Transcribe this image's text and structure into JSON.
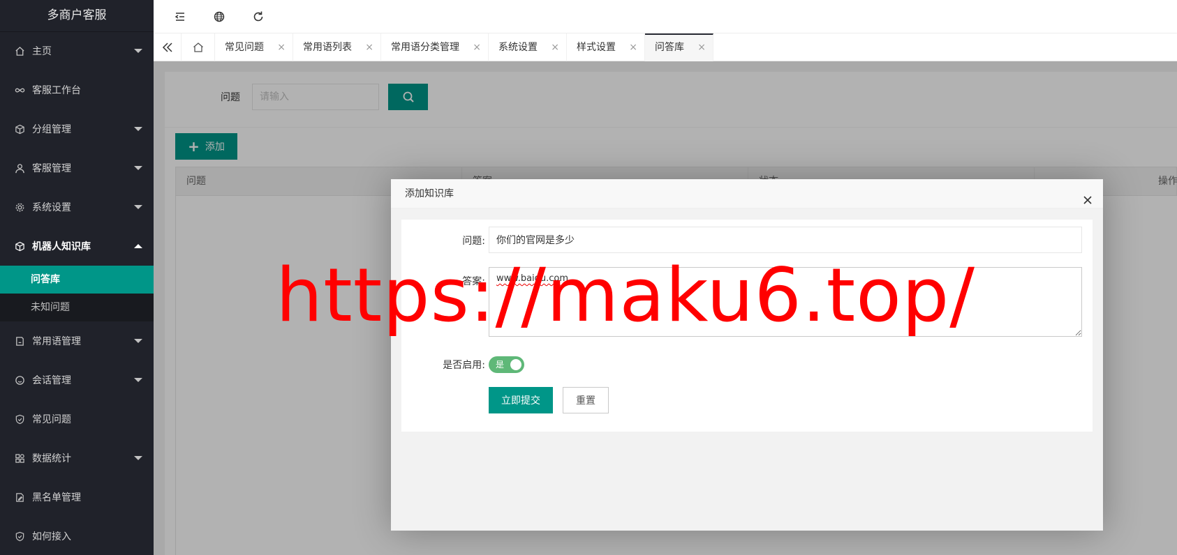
{
  "sidebar": {
    "title": "多商户客服",
    "items": [
      {
        "label": "主页",
        "icon": "home-icon",
        "has_children": true
      },
      {
        "label": "客服工作台",
        "icon": "infinity-icon",
        "has_children": false
      },
      {
        "label": "分组管理",
        "icon": "cube-icon",
        "has_children": true
      },
      {
        "label": "客服管理",
        "icon": "user-icon",
        "has_children": true
      },
      {
        "label": "系统设置",
        "icon": "gear-icon",
        "has_children": true
      },
      {
        "label": "机器人知识库",
        "icon": "cube-icon",
        "has_children": true,
        "open": true
      },
      {
        "label": "常用语管理",
        "icon": "note-icon",
        "has_children": true
      },
      {
        "label": "会话管理",
        "icon": "smile-icon",
        "has_children": true
      },
      {
        "label": "常见问题",
        "icon": "shield-icon",
        "has_children": false
      },
      {
        "label": "数据统计",
        "icon": "grid-icon",
        "has_children": true
      },
      {
        "label": "黑名单管理",
        "icon": "edit-icon",
        "has_children": false
      },
      {
        "label": "如何接入",
        "icon": "shield-icon",
        "has_children": false
      }
    ],
    "subitems": [
      {
        "label": "问答库",
        "active": true
      },
      {
        "label": "未知问题",
        "active": false
      }
    ]
  },
  "tabs": [
    {
      "label": "常见问题"
    },
    {
      "label": "常用语列表"
    },
    {
      "label": "常用语分类管理"
    },
    {
      "label": "系统设置"
    },
    {
      "label": "样式设置"
    },
    {
      "label": "问答库",
      "active": true
    }
  ],
  "tab_close_glyph": "×",
  "search": {
    "label": "问题",
    "placeholder": "请输入"
  },
  "add_button": {
    "plus": "+",
    "label": "添加"
  },
  "table": {
    "columns": [
      "问题",
      "答案",
      "状态",
      "操作"
    ]
  },
  "modal": {
    "title": "添加知识库",
    "question_label": "问题:",
    "question_value": "你们的官网是多少",
    "answer_label": "答案:",
    "answer_value": "www.baidu.com",
    "enable_label": "是否启用:",
    "switch_text": "是",
    "submit_label": "立即提交",
    "reset_label": "重置"
  },
  "watermark": "https://maku6.top/",
  "colors": {
    "accent": "#009688",
    "sidebar_bg": "#20222a",
    "switch_on": "#5fb878",
    "watermark": "#ff0000"
  }
}
